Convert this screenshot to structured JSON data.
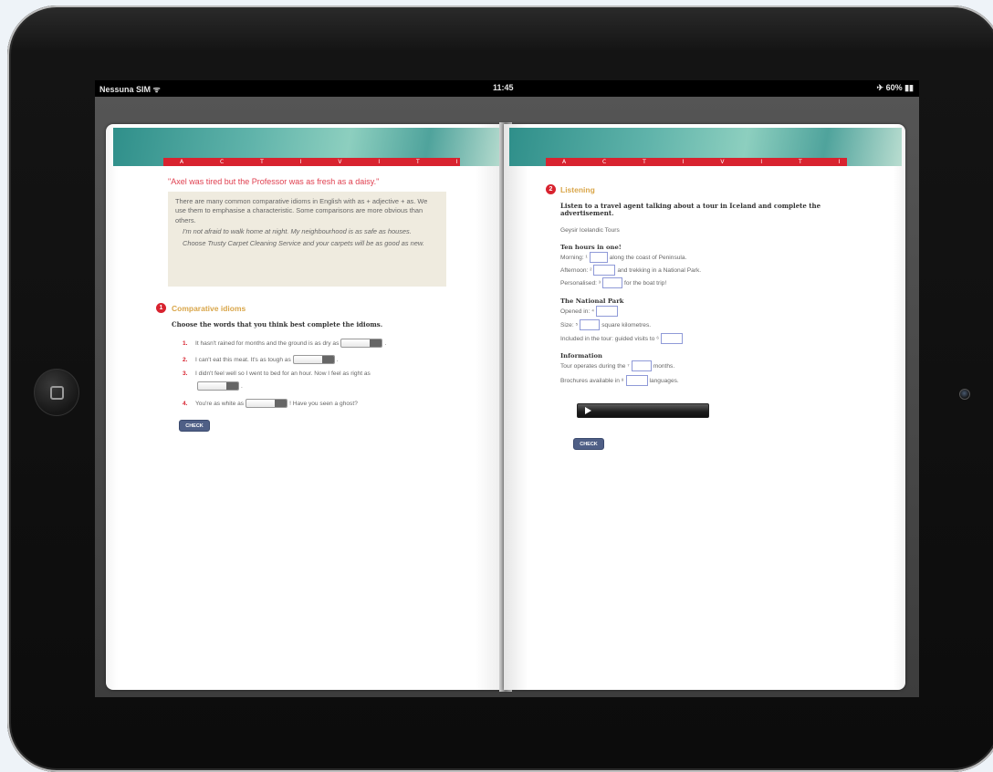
{
  "status_bar": {
    "carrier": "Nessuna SIM ᯤ",
    "time": "11:45",
    "battery": "✈ 60% ▮▮"
  },
  "left_page": {
    "banner_text": "A C T I V I T I E S",
    "quote": "\"Axel was tired but the Professor was as fresh as a daisy.\"",
    "info": {
      "text": "There are many common comparative idioms in English with as + adjective + as. We use them to emphasise a characteristic. Some comparisons are more obvious than others.",
      "example1": "I'm not afraid to walk home at night. My neighbourhood is as safe as houses.",
      "example2": "Choose Trusty Carpet Cleaning Service and your carpets will be as good as new."
    },
    "section": {
      "number": "1",
      "title": "Comparative idioms",
      "instruction": "Choose the words that you think best complete the idioms."
    },
    "questions": [
      {
        "num": "1.",
        "text": "It hasn't rained for months and the ground is as dry as",
        "tail": "."
      },
      {
        "num": "2.",
        "text": "I can't eat this meat. It's as tough as",
        "tail": "."
      },
      {
        "num": "3.",
        "text": "I didn't feel well so I went to bed for an hour. Now I feel as right as",
        "tail": "."
      },
      {
        "num": "4.",
        "text": "You're as white as",
        "tail": "! Have you seen a ghost?"
      }
    ],
    "check_label": "CHECK"
  },
  "right_page": {
    "banner_text": "A C T I V I T I E S",
    "section": {
      "number": "2",
      "title": "Listening",
      "instruction": "Listen to a travel agent talking about a tour in Iceland and complete the advertisement."
    },
    "tour_name": "Geysir Icelandic Tours",
    "group1": {
      "head": "Ten hours in one!",
      "lines": [
        {
          "pre": "Morning: ¹",
          "post": "along the coast of Peninsula."
        },
        {
          "pre": "Afternoon: ²",
          "post": "and trekking in a National Park."
        },
        {
          "pre": "Personalised: ³",
          "post": "for the boat trip!"
        }
      ]
    },
    "group2": {
      "head": "The National Park",
      "lines": [
        {
          "pre": "Opened in: ⁴",
          "post": ""
        },
        {
          "pre": "Size: ⁵",
          "post": "square kilometres."
        },
        {
          "pre": "Included in the tour: guided visits to ⁶",
          "post": ""
        }
      ]
    },
    "group3": {
      "head": "Information",
      "lines": [
        {
          "pre": "Tour operates during the ⁷",
          "post": "months."
        },
        {
          "pre": "Brochures available in ⁸",
          "post": "languages."
        }
      ]
    },
    "check_label": "CHECK"
  }
}
